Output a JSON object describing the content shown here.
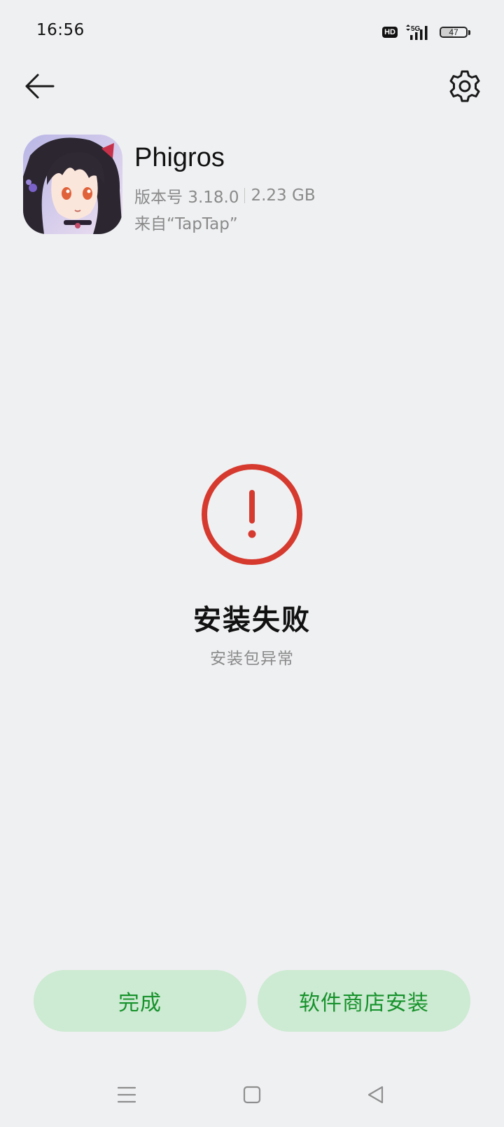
{
  "status_bar": {
    "time": "16:56",
    "hd_label": "HD",
    "network": "5G",
    "battery_level": "47",
    "battery_fraction": 0.47
  },
  "nav": {
    "back_icon": "arrow-left-icon",
    "settings_icon": "gear-icon"
  },
  "app": {
    "name": "Phigros",
    "version": "版本号 3.18.0",
    "size": "2.23 GB",
    "source": "来自“TapTap”"
  },
  "install_status": {
    "icon": "error-icon",
    "title": "安装失败",
    "subtitle": "安装包异常",
    "color": "#d63a2f"
  },
  "actions": {
    "done_label": "完成",
    "store_install_label": "软件商店安装",
    "button_bg": "#cdead2",
    "button_text_color": "#16922b"
  },
  "system_nav": {
    "menu_icon": "menu-icon",
    "home_icon": "square-home-icon",
    "back_icon": "triangle-back-icon"
  }
}
